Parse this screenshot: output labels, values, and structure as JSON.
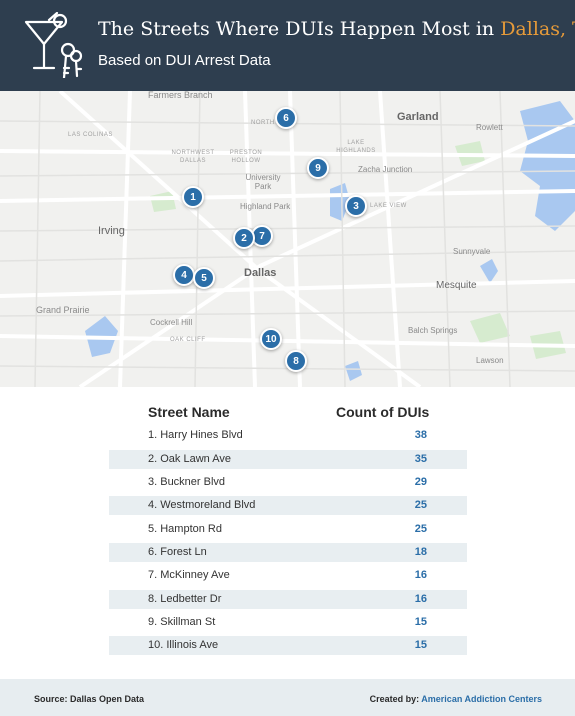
{
  "header": {
    "title_main": "The Streets Where DUIs Happen Most in ",
    "title_accent": "Dallas, TX",
    "subtitle": "Based on DUI Arrest Data",
    "accent_color": "#e59a3a",
    "background_color": "#2e3e4f",
    "logo_icon": "martini-glass-and-car-keys-icon"
  },
  "map": {
    "labels": {
      "farmers_branch": "Farmers Branch",
      "garland": "Garland",
      "rowlett": "Rowlett",
      "las_colinas": "LAS COLINAS",
      "north": "NORTH",
      "northwest_dallas": "NORTHWEST DALLAS",
      "preston_hollow": "PRESTON HOLLOW",
      "lake_highlands": "LAKE HIGHLANDS",
      "zacha_junction": "Zacha Junction",
      "university_park": "University Park",
      "highland_park": "Highland Park",
      "irving": "Irving",
      "lake_view": "LAKE VIEW",
      "sunnyvale": "Sunnyvale",
      "dallas": "Dallas",
      "mesquite": "Mesquite",
      "grand_prairie": "Grand Prairie",
      "cockrell_hill": "Cockrell Hill",
      "oak_cliff": "OAK CLIFF",
      "balch_springs": "Balch Springs",
      "lawson": "Lawson"
    },
    "markers": [
      "1",
      "2",
      "3",
      "4",
      "5",
      "6",
      "7",
      "8",
      "9",
      "10"
    ],
    "marker_color": "#2b6ea8"
  },
  "table": {
    "header_name": "Street Name",
    "header_count": "Count of DUIs",
    "rows": [
      {
        "name": "1. Harry Hines Blvd",
        "count": "38"
      },
      {
        "name": "2. Oak Lawn Ave",
        "count": "35"
      },
      {
        "name": "3. Buckner Blvd",
        "count": "29"
      },
      {
        "name": "4. Westmoreland Blvd",
        "count": "25"
      },
      {
        "name": "5. Hampton Rd",
        "count": "25"
      },
      {
        "name": "6. Forest Ln",
        "count": "18"
      },
      {
        "name": "7. McKinney Ave",
        "count": "16"
      },
      {
        "name": "8. Ledbetter Dr",
        "count": "16"
      },
      {
        "name": "9. Skillman St",
        "count": "15"
      },
      {
        "name": "10. Illinois Ave",
        "count": "15"
      }
    ]
  },
  "footer": {
    "source_label": "Source: Dallas Open Data",
    "created_label": "Created by: ",
    "created_brand": "American Addiction Centers"
  }
}
